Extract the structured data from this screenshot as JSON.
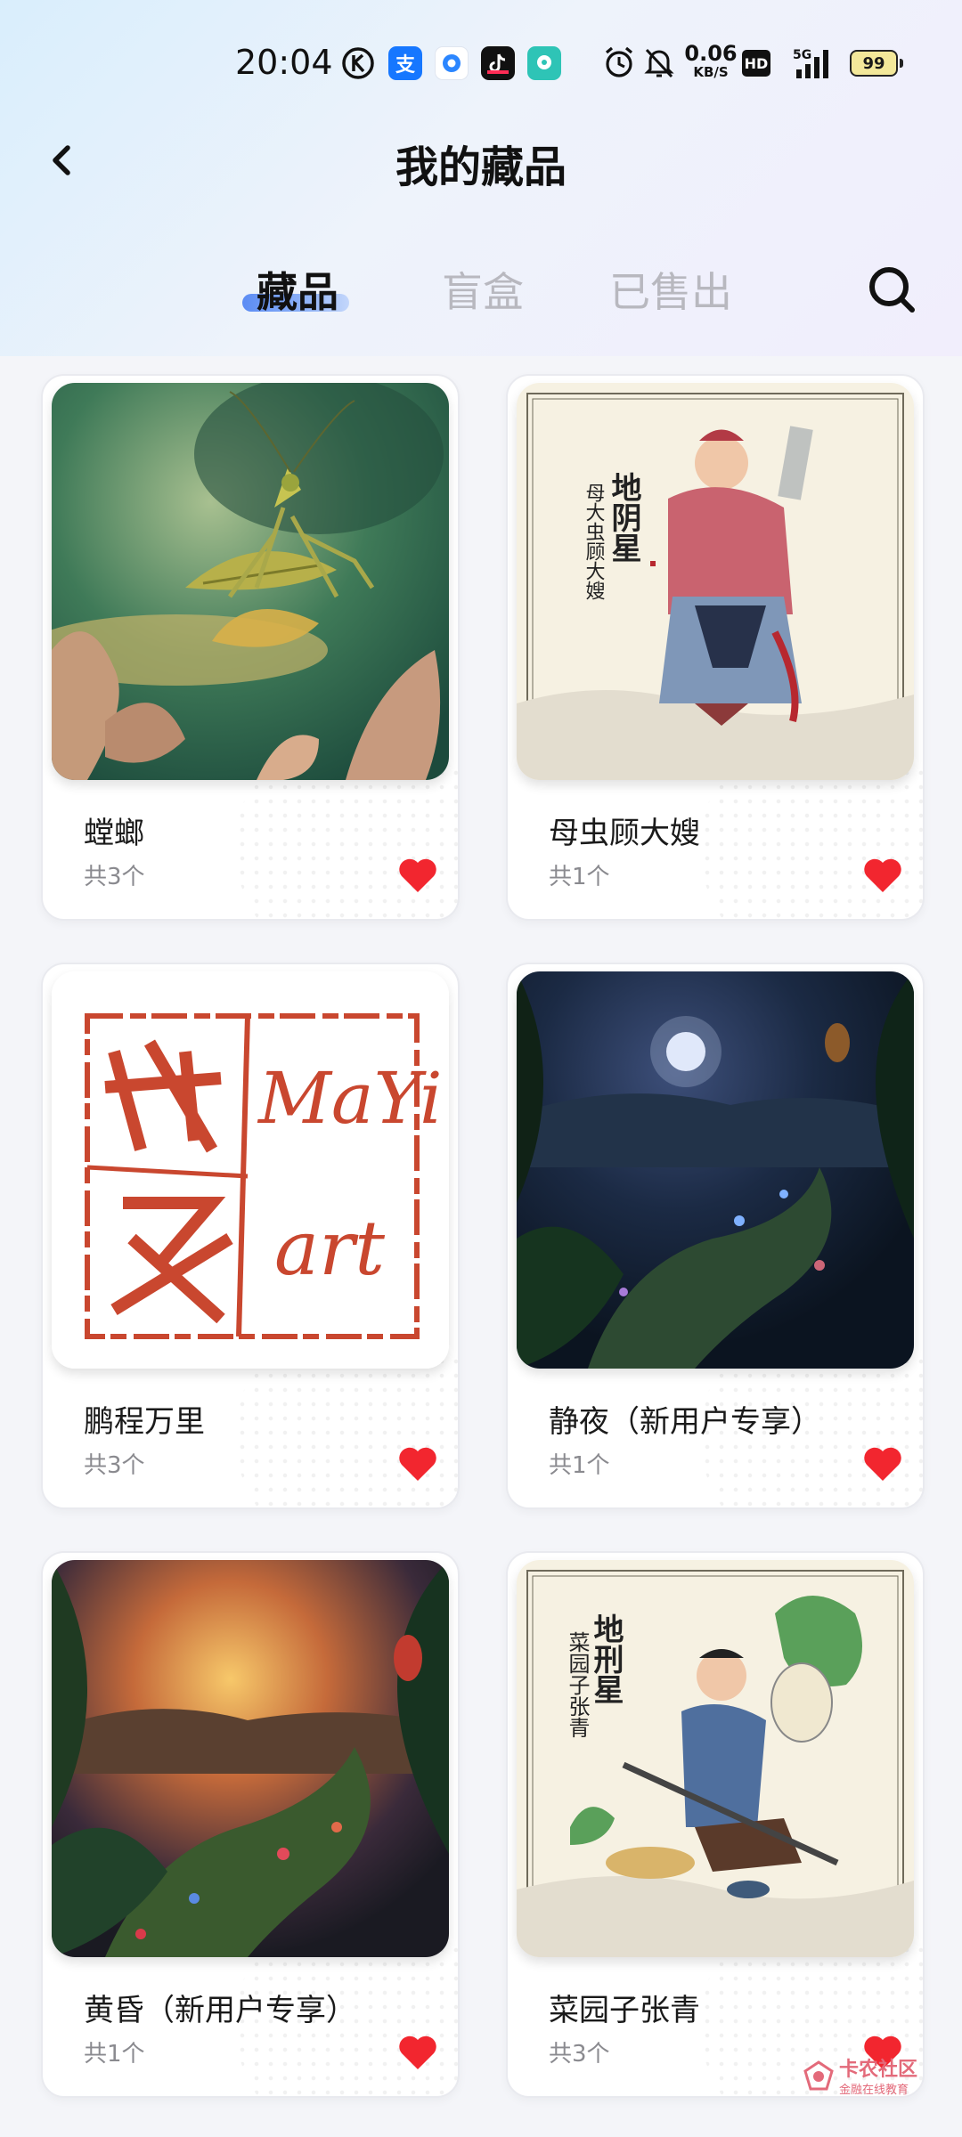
{
  "status_bar": {
    "time": "20:04",
    "speed_value": "0.06",
    "speed_unit": "KB/S",
    "hd": "HD",
    "network": "5G",
    "battery": "99",
    "app_icons": [
      "kugou-icon",
      "alipay-icon",
      "blue-circle-app-icon",
      "tiktok-icon",
      "chat-app-icon"
    ],
    "alipay_glyph": "支",
    "system_icons": [
      "alarm-icon",
      "mute-icon",
      "signal-icon"
    ]
  },
  "header": {
    "title": "我的藏品",
    "back_icon": "chevron-left-icon"
  },
  "tabs": [
    {
      "label": "藏品",
      "active": true
    },
    {
      "label": "盲盒",
      "active": false
    },
    {
      "label": "已售出",
      "active": false
    }
  ],
  "search_icon": "search-icon",
  "cards": [
    {
      "name": "螳螂",
      "count": "共3个",
      "image": "mantis-artwork"
    },
    {
      "name": "母虫顾大嫂",
      "count": "共1个",
      "image": "gu-dasao-artwork",
      "art_text_1": "地阴星",
      "art_text_2": "母大虫顾大嫂"
    },
    {
      "name": "鹏程万里",
      "count": "共3个",
      "image": "mayi-art-seal",
      "art_text_1": "MaYi",
      "art_text_2": "art"
    },
    {
      "name": "静夜（新用户专享）",
      "count": "共1个",
      "image": "night-jungle-artwork"
    },
    {
      "name": "黄昏（新用户专享）",
      "count": "共1个",
      "image": "dusk-jungle-artwork"
    },
    {
      "name": "菜园子张青",
      "count": "共3个",
      "image": "zhang-qing-artwork",
      "art_text_1": "地刑星",
      "art_text_2": "菜园子张青"
    }
  ],
  "colors": {
    "heart": "#f2262f",
    "tab_active": "#111111",
    "tab_inactive": "#b8b8bf",
    "accent": "#5b8cf4"
  },
  "watermark": {
    "text": "卡农社区",
    "subtext": "金融在线教育"
  }
}
